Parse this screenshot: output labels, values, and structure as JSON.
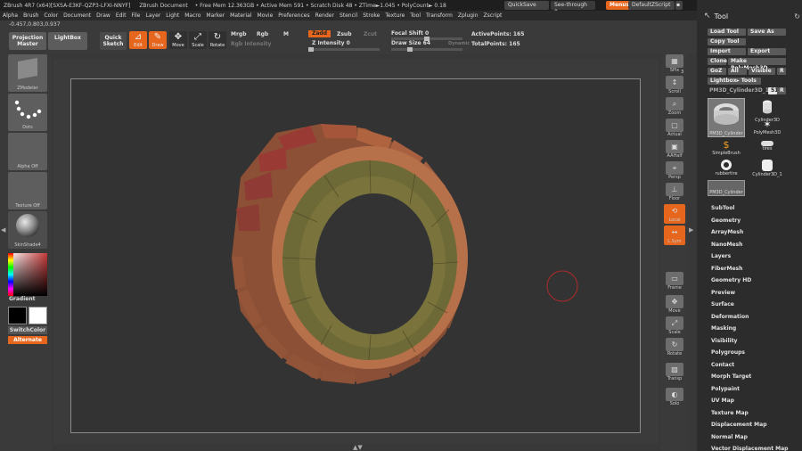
{
  "titlebar": {
    "app": "ZBrush 4R7 (x64)[SXSA-E3KF-QZP3-LFXI-NNYF]",
    "document": "ZBrush Document",
    "stats": "• Free Mem 12.363GB • Active Mem 591 • Scratch Disk 48 • ZTime►1.045 • PolyCount► 0.18",
    "quicksave": "QuickSave",
    "seethrough": "See-through",
    "seethrough_value": "0",
    "menus": "Menus",
    "script": "DefaultZScript"
  },
  "menubar": [
    "Alpha",
    "Brush",
    "Color",
    "Document",
    "Draw",
    "Edit",
    "File",
    "Layer",
    "Light",
    "Macro",
    "Marker",
    "Material",
    "Movie",
    "Preferences",
    "Render",
    "Stencil",
    "Stroke",
    "Texture",
    "Tool",
    "Transform",
    "Zplugin",
    "Zscript"
  ],
  "coords": "-0.457,0.803,0.937",
  "toolbar": {
    "projection_master": "Projection Master",
    "lightbox": "LightBox",
    "quick_sketch": "Quick Sketch",
    "edit": "Edit",
    "draw": "Draw",
    "move": "Move",
    "scale": "Scale",
    "rotate": "Rotate",
    "mrgb": "Mrgb",
    "rgb": "Rgb",
    "m": "M",
    "zadd": "Zadd",
    "zsub": "Zsub",
    "zcut": "Zcut",
    "rgb_intensity": "Rgb Intensity",
    "z_intensity": "Z Intensity",
    "z_intensity_value": "0",
    "focal_shift": "Focal Shift",
    "focal_shift_value": "0",
    "draw_size": "Draw Size",
    "draw_size_value": "64",
    "dynamic": "Dynamic",
    "active_points": "ActivePoints: 165",
    "total_points": "TotalPoints: 165"
  },
  "leftshelf": {
    "brush": "ZModeler",
    "stroke": "Dots",
    "alpha": "Alpha Off",
    "texture": "Texture Off",
    "material": "SkinShade4",
    "gradient": "Gradient",
    "switchcolor": "SwitchColor",
    "alternate": "Alternate"
  },
  "rightstrip": [
    "SPix",
    "Scroll",
    "Zoom",
    "Actual",
    "AAHalf",
    "Persp",
    "Floor",
    "Local",
    "L.Sym",
    "Frame",
    "Move",
    "Scale",
    "Rotate",
    "Transp",
    "Solo"
  ],
  "rightstrip_values": {
    "spix": "3"
  },
  "toolpanel": {
    "title": "Tool",
    "load_tool": "Load Tool",
    "save_as": "Save As",
    "copy_tool": "Copy Tool",
    "import": "Import",
    "export": "Export",
    "clone": "Clone",
    "make_polymesh": "Make PolyMesh3D",
    "goz": "GoZ",
    "all": "All",
    "visible": "Visible",
    "r": "R",
    "lightbox_tools": "Lightbox▸ Tools",
    "current_tool": "PM3D_Cylinder3D_1.",
    "current_tool_count": "51",
    "thumbs": [
      "PM3D_Cylinder",
      "Cylinder3D",
      "PolyMesh3D",
      "SimpleBrush",
      "tires",
      "rubbertire",
      "Cylinder3D_1",
      "PM3D_Cylinder"
    ],
    "sections": [
      "SubTool",
      "Geometry",
      "ArrayMesh",
      "NanoMesh",
      "Layers",
      "FiberMesh",
      "Geometry HD",
      "Preview",
      "Surface",
      "Deformation",
      "Masking",
      "Visibility",
      "Polygroups",
      "Contact",
      "Morph Target",
      "Polypaint",
      "UV Map",
      "Texture Map",
      "Displacement Map",
      "Normal Map",
      "Vector Displacement Map"
    ]
  },
  "colors": {
    "accent": "#e6661e",
    "mesh_brown": "#9a5a3c",
    "mesh_olive": "#6f6a3a",
    "mesh_red": "#9a3a35"
  }
}
